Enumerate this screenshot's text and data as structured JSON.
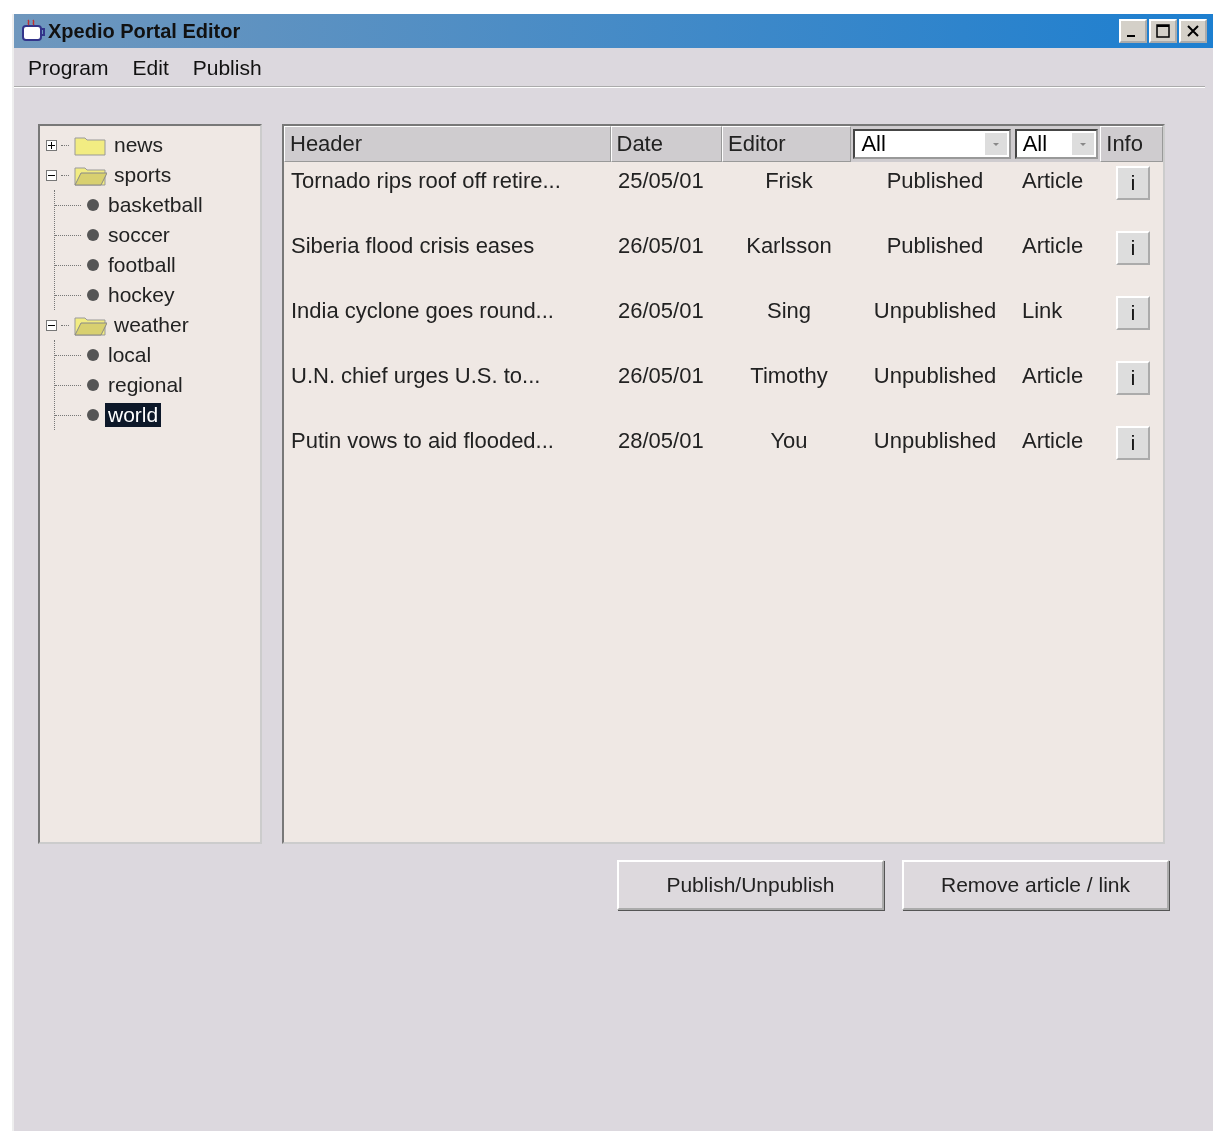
{
  "window": {
    "title": "Xpedio Portal Editor"
  },
  "menu": [
    "Program",
    "Edit",
    "Publish"
  ],
  "tree": [
    {
      "label": "news",
      "kind": "folder",
      "expanded": false,
      "selected": false
    },
    {
      "label": "sports",
      "kind": "folder",
      "expanded": true,
      "selected": false,
      "children": [
        {
          "label": "basketball",
          "kind": "leaf",
          "selected": false
        },
        {
          "label": "soccer",
          "kind": "leaf",
          "selected": false
        },
        {
          "label": "football",
          "kind": "leaf",
          "selected": false
        },
        {
          "label": "hockey",
          "kind": "leaf",
          "selected": false
        }
      ]
    },
    {
      "label": "weather",
      "kind": "folder",
      "expanded": true,
      "selected": false,
      "children": [
        {
          "label": "local",
          "kind": "leaf",
          "selected": false
        },
        {
          "label": "regional",
          "kind": "leaf",
          "selected": false
        },
        {
          "label": "world",
          "kind": "leaf",
          "selected": true
        }
      ]
    }
  ],
  "table": {
    "columns": [
      {
        "kind": "text",
        "label": "Header"
      },
      {
        "kind": "text",
        "label": "Date"
      },
      {
        "kind": "text",
        "label": "Editor"
      },
      {
        "kind": "filter",
        "value": "All"
      },
      {
        "kind": "filter",
        "value": "All"
      },
      {
        "kind": "text",
        "label": "Info"
      }
    ],
    "rows": [
      {
        "header": "Tornado rips roof off retire...",
        "date": "25/05/01",
        "editor": "Frisk",
        "status": "Published",
        "type": "Article",
        "info": "i"
      },
      {
        "header": "Siberia flood crisis eases",
        "date": "26/05/01",
        "editor": "Karlsson",
        "status": "Published",
        "type": "Article",
        "info": "i"
      },
      {
        "header": "India cyclone goes round...",
        "date": "26/05/01",
        "editor": "Sing",
        "status": "Unpublished",
        "type": "Link",
        "info": "i"
      },
      {
        "header": "U.N. chief urges U.S. to...",
        "date": "26/05/01",
        "editor": "Timothy",
        "status": "Unpublished",
        "type": "Article",
        "info": "i"
      },
      {
        "header": "Putin vows to aid flooded...",
        "date": "28/05/01",
        "editor": "You",
        "status": "Unpublished",
        "type": "Article",
        "info": "i"
      }
    ]
  },
  "buttons": [
    "Publish/Unpublish",
    "Remove article / link"
  ]
}
